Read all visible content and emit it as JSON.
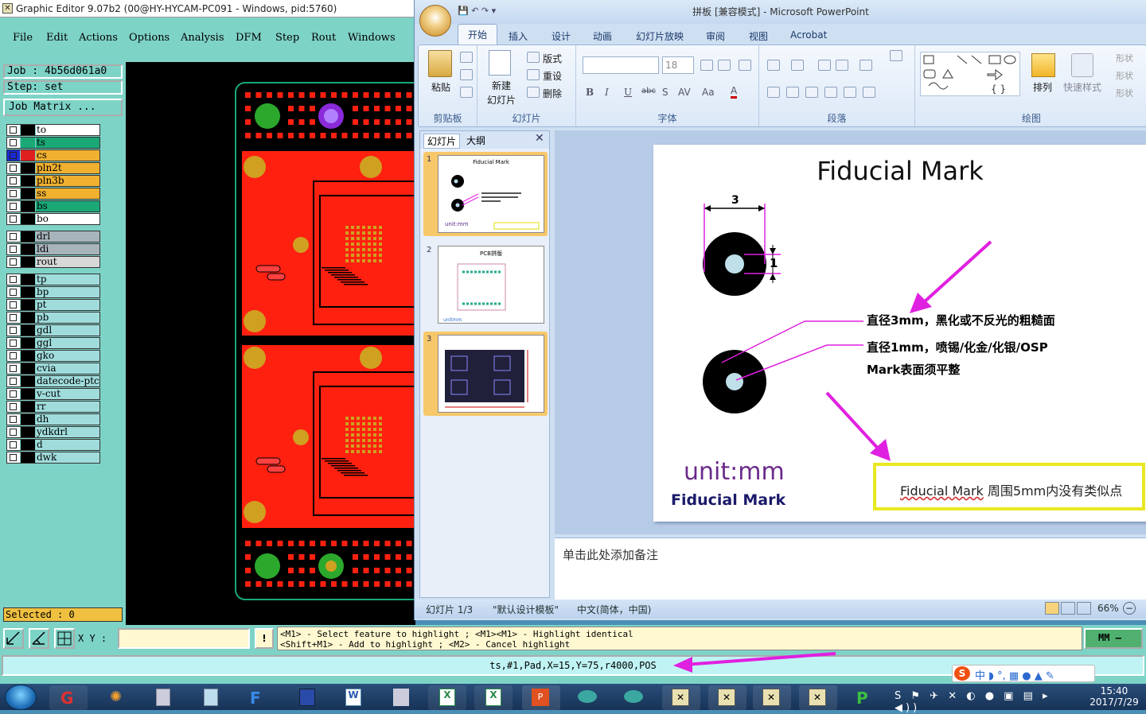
{
  "ge": {
    "title": "Graphic Editor 9.07b2 (00@HY-HYCAM-PC091 - Windows, pid:5760)",
    "menu": [
      "File",
      "Edit",
      "Actions",
      "Options",
      "Analysis",
      "DFM",
      "Step",
      "Rout",
      "Windows"
    ],
    "job": "Job  : 4b56d061a0",
    "step": "Step: set",
    "job_matrix": "Job Matrix ...",
    "layers": [
      {
        "name": "to",
        "color": "#ffffff",
        "sw": "#000000"
      },
      {
        "name": "ts",
        "color": "#1aa877",
        "sw": "#1aa877"
      },
      {
        "name": "cs",
        "color": "#f0b030",
        "sw": "#e02020",
        "selected": true
      },
      {
        "name": "pln2t",
        "color": "#f0b030",
        "sw": "#000000"
      },
      {
        "name": "pln3b",
        "color": "#f0b030",
        "sw": "#000000"
      },
      {
        "name": "ss",
        "color": "#f0b030",
        "sw": "#000000"
      },
      {
        "name": "bs",
        "color": "#1aa877",
        "sw": "#000000"
      },
      {
        "name": "bo",
        "color": "#ffffff",
        "sw": "#000000"
      },
      {
        "name": "drl",
        "color": "#a8b4bc",
        "sw": "#000000"
      },
      {
        "name": "ldi",
        "color": "#a8b4bc",
        "sw": "#000000"
      },
      {
        "name": "rout",
        "color": "#d8d8d8",
        "sw": "#000000"
      },
      {
        "name": "tp",
        "color": "#a0dcdc",
        "sw": "#000000"
      },
      {
        "name": "bp",
        "color": "#a0dcdc",
        "sw": "#000000"
      },
      {
        "name": "pt",
        "color": "#a0dcdc",
        "sw": "#000000"
      },
      {
        "name": "pb",
        "color": "#a0dcdc",
        "sw": "#000000"
      },
      {
        "name": "gdl",
        "color": "#a0dcdc",
        "sw": "#000000"
      },
      {
        "name": "ggl",
        "color": "#a0dcdc",
        "sw": "#000000"
      },
      {
        "name": "gko",
        "color": "#a0dcdc",
        "sw": "#000000"
      },
      {
        "name": "cvia",
        "color": "#a0dcdc",
        "sw": "#000000"
      },
      {
        "name": "datecode-ptc",
        "color": "#a0dcdc",
        "sw": "#000000"
      },
      {
        "name": "v-cut",
        "color": "#a0dcdc",
        "sw": "#000000"
      },
      {
        "name": "rr",
        "color": "#a0dcdc",
        "sw": "#000000"
      },
      {
        "name": "dh",
        "color": "#a0dcdc",
        "sw": "#000000"
      },
      {
        "name": "ydkdrl",
        "color": "#a0dcdc",
        "sw": "#000000"
      },
      {
        "name": "d",
        "color": "#a0dcdc",
        "sw": "#000000"
      },
      {
        "name": "dwk",
        "color": "#a0dcdc",
        "sw": "#000000"
      }
    ],
    "selected": "Selected : 0",
    "xy_label": "X Y :",
    "hint_line1": "<M1> - Select feature to highlight ; <M1><M1> - Highlight identical",
    "hint_line2": "<Shift+M1> - Add to highlight ; <M2> - Cancel highlight",
    "units": "MM",
    "feature_info": "ts,#1,Pad,X=15,Y=75,r4000,POS"
  },
  "ppt": {
    "title": "拼板 [兼容模式] - Microsoft PowerPoint",
    "tabs": [
      "开始",
      "插入",
      "设计",
      "动画",
      "幻灯片放映",
      "审阅",
      "视图",
      "Acrobat"
    ],
    "ribbon": {
      "paste": "粘贴",
      "clipboard": "剪贴板",
      "new_slide_1": "新建",
      "new_slide_2": "幻灯片",
      "layout": "版式",
      "reset": "重设",
      "delete": "删除",
      "slides_group": "幻灯片",
      "font_size": "18",
      "font_group": "字体",
      "para_group": "段落",
      "arrange": "排列",
      "quick_styles": "快速样式",
      "draw_group": "绘图",
      "shape_fill": "形状",
      "shape_outline": "形状",
      "shape_effect": "形状"
    },
    "panel_tabs": [
      "幻灯片",
      "大纲"
    ],
    "thumbs": [
      {
        "num": "1",
        "title": "Fiducial  Mark"
      },
      {
        "num": "2",
        "title": "PCB拼版"
      },
      {
        "num": "3",
        "title": ""
      }
    ],
    "slide": {
      "title": "Fiducial   Mark",
      "dim_3": "3",
      "dim_1": "1",
      "text1": "直径3mm，黑化或不反光的粗糙面",
      "text2": "直径1mm，喷锡/化金/化银/OSP",
      "text3": "Mark表面须平整",
      "unit": "unit:mm",
      "fiducial": "Fiducial  Mark",
      "box_text_en": "Fiducial  Mark",
      "box_text_cn": " 周围5mm内没有类似点"
    },
    "notes": "单击此处添加备注",
    "status": {
      "slide_num": "幻灯片 1/3",
      "theme": "\"默认设计模板\"",
      "lang": "中文(简体，中国)",
      "zoom": "66%"
    }
  },
  "taskbar": {
    "time": "15:40",
    "date": "2017/7/29"
  },
  "colors": {
    "teal": "#7ed3c7",
    "pcb_red": "#ff2010",
    "magenta": "#e020e0"
  }
}
